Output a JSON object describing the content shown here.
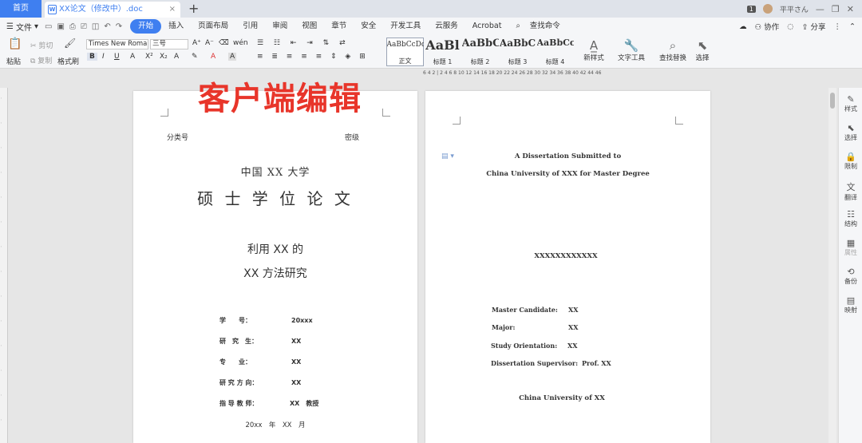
{
  "tabs": {
    "home": "首页",
    "doc_title": "XX论文（修改中）.doc",
    "doc_icon": "W",
    "close": "×",
    "new": "+"
  },
  "titlebar": {
    "badge": "1",
    "user": "平平さん"
  },
  "menubar": {
    "file": "文件",
    "items": [
      "开始",
      "插入",
      "页面布局",
      "引用",
      "审阅",
      "视图",
      "章节",
      "安全",
      "开发工具",
      "云服务",
      "Acrobat",
      "查找命令"
    ],
    "collab": "协作",
    "share": "分享"
  },
  "ribbon": {
    "paste": "粘贴",
    "cut": "剪切",
    "copy": "复制",
    "format_painter": "格式刷",
    "font": "Times New Roma",
    "size": "三号",
    "styles": [
      {
        "sample": "AaBbCcDd",
        "label": "正文"
      },
      {
        "sample": "AaBl",
        "label": "标题 1"
      },
      {
        "sample": "AaBbC",
        "label": "标题 2"
      },
      {
        "sample": "AaBbC",
        "label": "标题 3"
      },
      {
        "sample": "AaBbCc",
        "label": "标题 4"
      }
    ],
    "new_style": "新样式",
    "text_tools": "文字工具",
    "find_replace": "查找替换",
    "select": "选择"
  },
  "ruler_ticks": "6  4  2  |  2  4  6  8  10  12  14  16  18  20  22  24  26  28  30  32  34  36  38  40  42  44  46",
  "overlay_text": "客户端编辑",
  "page1": {
    "class_no": "分类号",
    "secret": "密级",
    "university": "中国 XX 大学",
    "degree_title": "硕 士 学 位 论 文",
    "title_line1": "利用 XX 的",
    "title_line2": "XX 方法研究",
    "fields": [
      {
        "label": "学　　号：",
        "value": "20xxx"
      },
      {
        "label": "研　究　生：",
        "value": "XX"
      },
      {
        "label": "专　　业：",
        "value": "XX"
      },
      {
        "label": "研 究 方 向：",
        "value": "XX"
      },
      {
        "label": "指 导 教 师：",
        "value": "XX　教授"
      }
    ],
    "date": "20xx　年　XX　月"
  },
  "page2": {
    "line1": "A Dissertation Submitted to",
    "line2": "China University of XXX for Master Degree",
    "title": "XXXXXXXXXXXX",
    "fields": [
      {
        "label": "Master Candidate:",
        "value": "XX"
      },
      {
        "label": "Major:",
        "value": "XX"
      },
      {
        "label": "Study Orientation:",
        "value": "XX"
      },
      {
        "label": "Dissertation Supervisor:",
        "value": "Prof. XX"
      }
    ],
    "footer": "China University of XX"
  },
  "sidebar": [
    "样式",
    "选择",
    "限制",
    "翻译",
    "结构",
    "属性",
    "备份",
    "映射"
  ],
  "colors": {
    "accent": "#3f7ff0",
    "overlay": "#e8352a"
  }
}
